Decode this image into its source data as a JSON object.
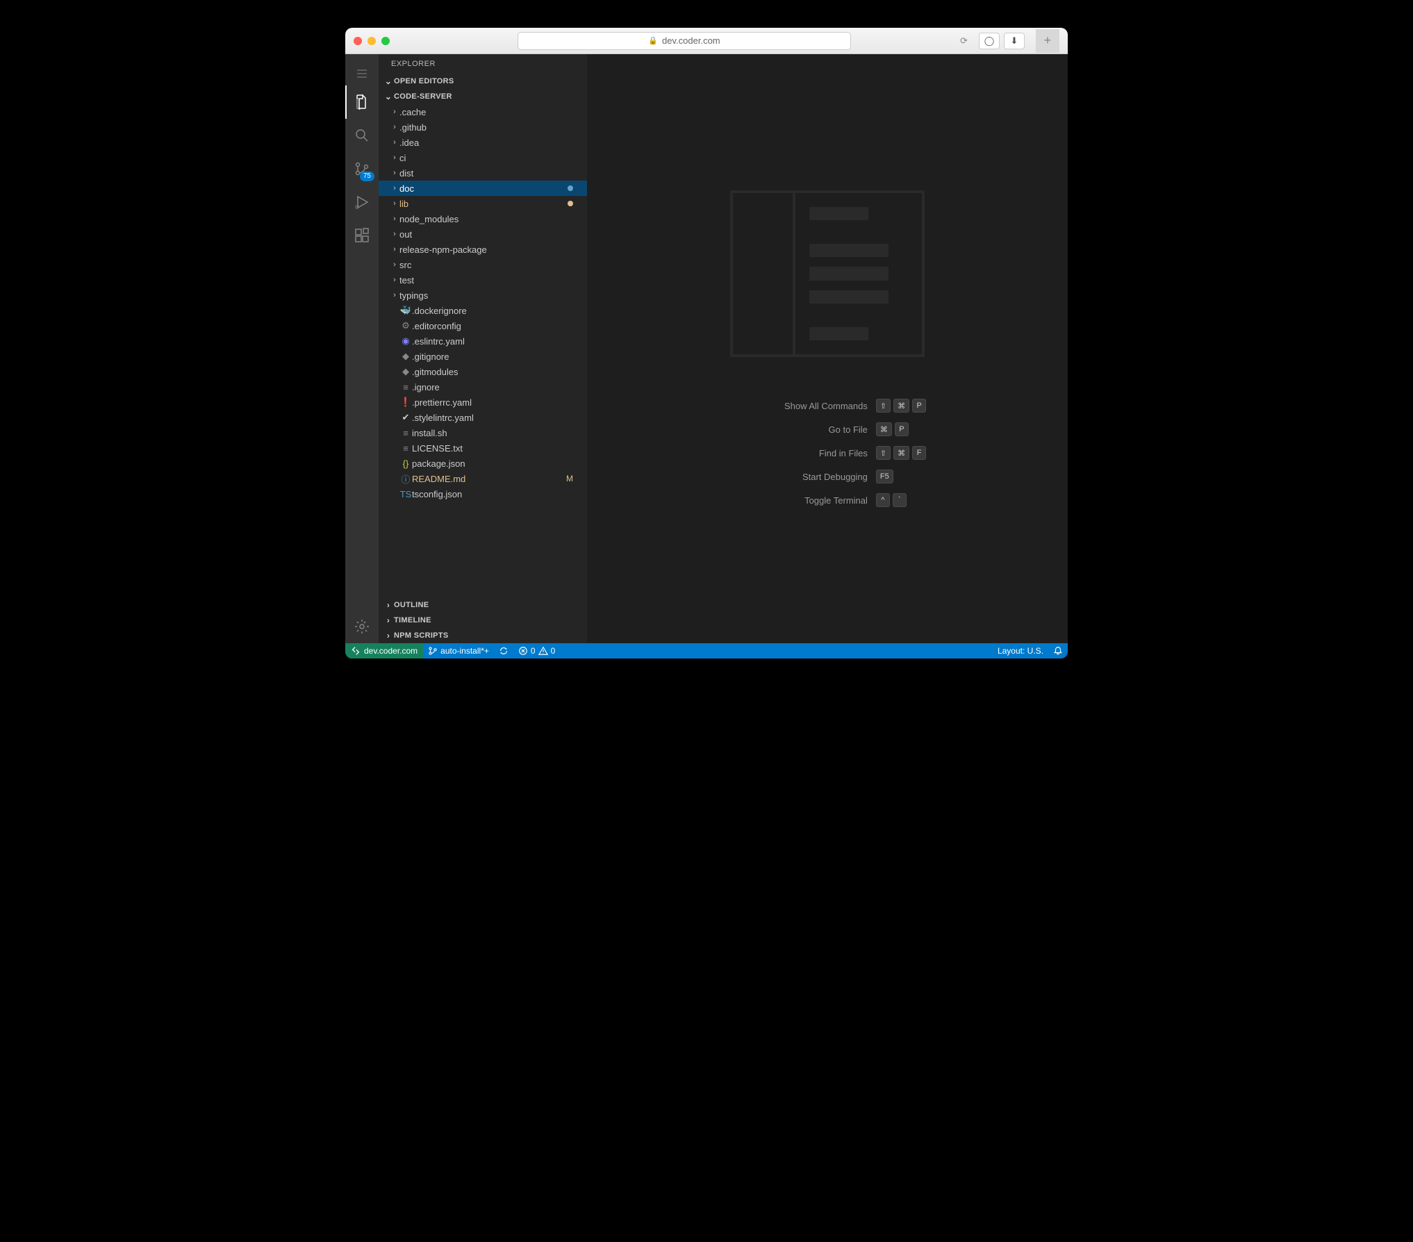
{
  "browser": {
    "url": "dev.coder.com"
  },
  "sidebar": {
    "title": "Explorer",
    "sections": {
      "open_editors": "Open Editors",
      "project": "code-server",
      "outline": "Outline",
      "timeline": "Timeline",
      "npm_scripts": "NPM Scripts"
    }
  },
  "scm_badge": "75",
  "tree": [
    {
      "type": "folder",
      "name": ".cache"
    },
    {
      "type": "folder",
      "name": ".github"
    },
    {
      "type": "folder",
      "name": ".idea"
    },
    {
      "type": "folder",
      "name": "ci"
    },
    {
      "type": "folder",
      "name": "dist"
    },
    {
      "type": "folder",
      "name": "doc",
      "selected": true,
      "dot": "#66a3cc"
    },
    {
      "type": "folder",
      "name": "lib",
      "modified": true,
      "dot": "#e2c08d"
    },
    {
      "type": "folder",
      "name": "node_modules"
    },
    {
      "type": "folder",
      "name": "out"
    },
    {
      "type": "folder",
      "name": "release-npm-package"
    },
    {
      "type": "folder",
      "name": "src"
    },
    {
      "type": "folder",
      "name": "test"
    },
    {
      "type": "folder",
      "name": "typings"
    },
    {
      "type": "file",
      "name": ".dockerignore",
      "icon": "docker",
      "color": "#888"
    },
    {
      "type": "file",
      "name": ".editorconfig",
      "icon": "gear",
      "color": "#888"
    },
    {
      "type": "file",
      "name": ".eslintrc.yaml",
      "icon": "eslint",
      "color": "#8080ff"
    },
    {
      "type": "file",
      "name": ".gitignore",
      "icon": "git",
      "color": "#888"
    },
    {
      "type": "file",
      "name": ".gitmodules",
      "icon": "git",
      "color": "#888"
    },
    {
      "type": "file",
      "name": ".ignore",
      "icon": "text",
      "color": "#888"
    },
    {
      "type": "file",
      "name": ".prettierrc.yaml",
      "icon": "prettier",
      "color": "#b58900"
    },
    {
      "type": "file",
      "name": ".stylelintrc.yaml",
      "icon": "stylelint",
      "color": "#ccc"
    },
    {
      "type": "file",
      "name": "install.sh",
      "icon": "text",
      "color": "#888"
    },
    {
      "type": "file",
      "name": "LICENSE.txt",
      "icon": "text",
      "color": "#888"
    },
    {
      "type": "file",
      "name": "package.json",
      "icon": "json",
      "color": "#cbcb41"
    },
    {
      "type": "file",
      "name": "README.md",
      "icon": "info",
      "color": "#519aba",
      "modified": true,
      "tag": "M"
    },
    {
      "type": "file",
      "name": "tsconfig.json",
      "icon": "ts",
      "color": "#519aba"
    }
  ],
  "shortcuts": [
    {
      "label": "Show All Commands",
      "keys": [
        "⇧",
        "⌘",
        "P"
      ]
    },
    {
      "label": "Go to File",
      "keys": [
        "⌘",
        "P"
      ]
    },
    {
      "label": "Find in Files",
      "keys": [
        "⇧",
        "⌘",
        "F"
      ]
    },
    {
      "label": "Start Debugging",
      "keys": [
        "F5"
      ]
    },
    {
      "label": "Toggle Terminal",
      "keys": [
        "^",
        "`"
      ]
    }
  ],
  "statusbar": {
    "remote": "dev.coder.com",
    "branch": "auto-install*+",
    "errors": "0",
    "warnings": "0",
    "layout": "Layout: U.S."
  }
}
